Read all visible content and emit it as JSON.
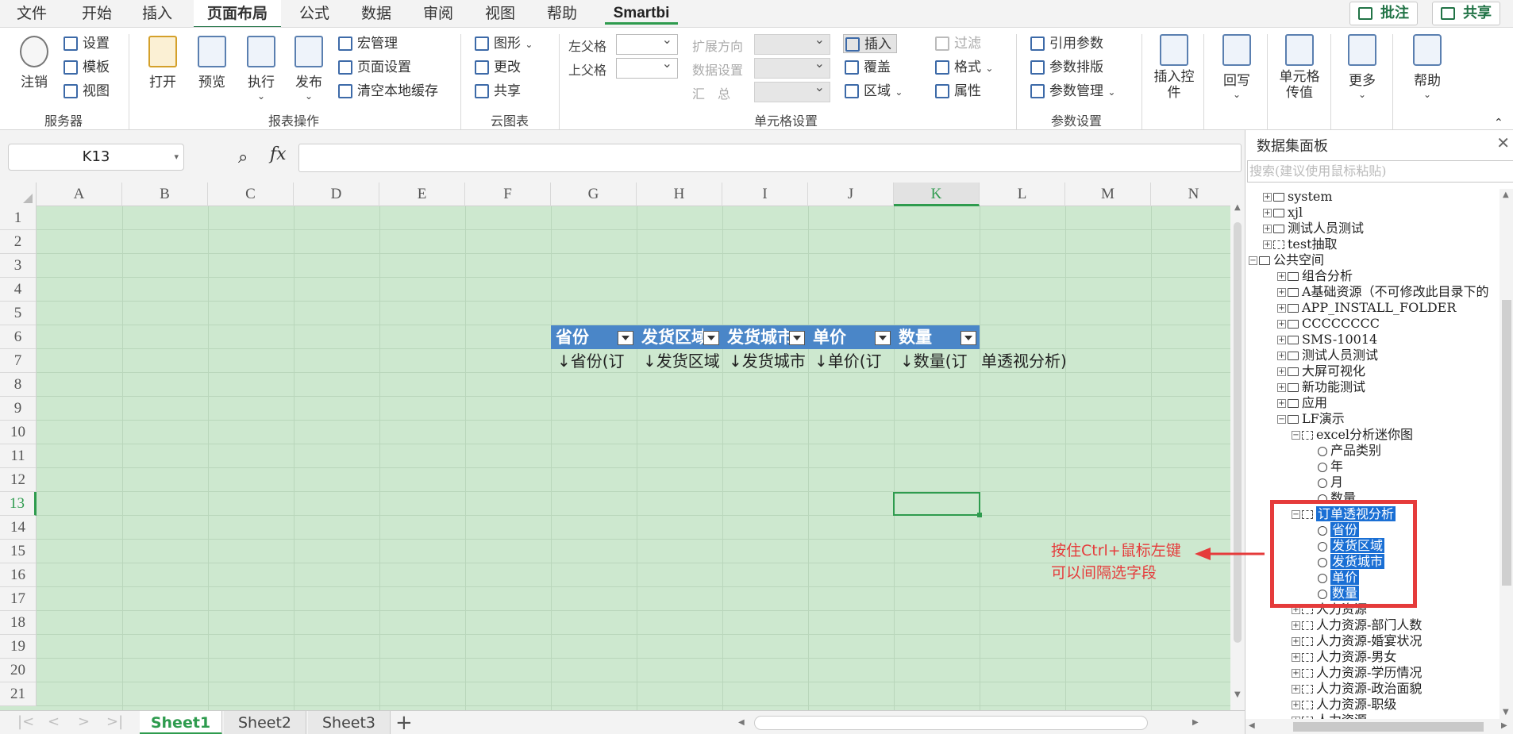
{
  "tabs": [
    "文件",
    "开始",
    "插入",
    "页面布局",
    "公式",
    "数据",
    "审阅",
    "视图",
    "帮助",
    "Smartbi"
  ],
  "active_tab": "页面布局",
  "top_buttons": {
    "comment": "批注",
    "share": "共享"
  },
  "ribbon": {
    "server": {
      "logout": "注销",
      "settings": "设置",
      "template": "模板",
      "view": "视图",
      "group": "服务器"
    },
    "report": {
      "open": "打开",
      "preview": "预览",
      "execute": "执行",
      "publish": "发布",
      "macro": "宏管理",
      "page_setup": "页面设置",
      "clear_cache": "清空本地缓存",
      "group": "报表操作"
    },
    "cloud": {
      "chart": "图形",
      "change": "更改",
      "share": "共享",
      "group": "云图表"
    },
    "cell": {
      "left_parent": "左父格",
      "top_parent": "上父格",
      "expand_dir": "扩展方向",
      "data_setting": "数据设置",
      "summary": "汇　总",
      "insert": "插入",
      "overwrite": "覆盖",
      "area": "区域",
      "filter": "过滤",
      "format": "格式",
      "attribute": "属性",
      "group": "单元格设置"
    },
    "param": {
      "ref": "引用参数",
      "layout": "参数排版",
      "manage": "参数管理",
      "group": "参数设置"
    },
    "extra": {
      "insert_ctrl": "插入控件",
      "writeback": "回写",
      "cell_pass": "单元格传值",
      "more": "更多",
      "help": "帮助"
    }
  },
  "name_box": "K13",
  "formula_value": "",
  "columns": [
    "A",
    "B",
    "C",
    "D",
    "E",
    "F",
    "G",
    "H",
    "I",
    "J",
    "K",
    "L",
    "M",
    "N"
  ],
  "selected_column": "K",
  "rows": [
    "1",
    "2",
    "3",
    "4",
    "5",
    "6",
    "7",
    "8",
    "9",
    "10",
    "11",
    "12",
    "13",
    "14",
    "15",
    "16",
    "17",
    "18",
    "19",
    "20",
    "21"
  ],
  "selected_row": "13",
  "table_headers": [
    "省份",
    "发货区域",
    "发货城市",
    "单价",
    "数量"
  ],
  "table_data_cells": [
    "↓省份(订",
    "↓发货区域",
    "↓发货城市",
    "↓单价(订",
    "↓数量(订"
  ],
  "table_data_tail": "单透视分析)",
  "sheets": [
    "Sheet1",
    "Sheet2",
    "Sheet3"
  ],
  "active_sheet": "Sheet1",
  "panel": {
    "title": "数据集面板",
    "search_placeholder": "搜索(建议使用鼠标粘贴)",
    "tree": [
      {
        "label": "system",
        "icon": "folder",
        "box": "+"
      },
      {
        "label": "xjl",
        "icon": "folder",
        "box": "+"
      },
      {
        "label": "测试人员测试",
        "icon": "folder",
        "box": "+"
      },
      {
        "label": "test抽取",
        "icon": "report",
        "box": "+"
      },
      {
        "label": "公共空间",
        "icon": "folder",
        "box": "−"
      },
      {
        "label": "组合分析",
        "icon": "combo",
        "box": "+"
      },
      {
        "label": "A基础资源（不可修改此目录下的",
        "icon": "folder",
        "box": "+"
      },
      {
        "label": "APP_INSTALL_FOLDER",
        "icon": "folder",
        "box": "+"
      },
      {
        "label": "CCCCCCCC",
        "icon": "folder",
        "box": "+"
      },
      {
        "label": "SMS-10014",
        "icon": "folder",
        "box": "+"
      },
      {
        "label": "测试人员测试",
        "icon": "folder",
        "box": "+"
      },
      {
        "label": "大屏可视化",
        "icon": "folder",
        "box": "+"
      },
      {
        "label": "新功能测试",
        "icon": "folder",
        "box": "+"
      },
      {
        "label": "应用",
        "icon": "folder",
        "box": "+"
      },
      {
        "label": "LF演示",
        "icon": "folder",
        "box": "−"
      },
      {
        "label": "excel分析迷你图",
        "icon": "report",
        "box": "−"
      },
      {
        "label": "产品类别",
        "icon": "field"
      },
      {
        "label": "年",
        "icon": "field"
      },
      {
        "label": "月",
        "icon": "field"
      },
      {
        "label": "数量",
        "icon": "field"
      },
      {
        "label": "订单透视分析",
        "icon": "report",
        "box": "−",
        "hl": true
      },
      {
        "label": "省份",
        "icon": "field",
        "hl": true
      },
      {
        "label": "发货区域",
        "icon": "field",
        "hl": true
      },
      {
        "label": "发货城市",
        "icon": "field",
        "hl": true
      },
      {
        "label": "单价",
        "icon": "field",
        "hl": true
      },
      {
        "label": "数量",
        "icon": "field",
        "hl": true
      },
      {
        "label": "人力资源",
        "icon": "report",
        "box": "+"
      },
      {
        "label": "人力资源-部门人数",
        "icon": "report",
        "box": "+"
      },
      {
        "label": "人力资源-婚宴状况",
        "icon": "report",
        "box": "+"
      },
      {
        "label": "人力资源-男女",
        "icon": "report",
        "box": "+"
      },
      {
        "label": "人力资源-学历情况",
        "icon": "report",
        "box": "+"
      },
      {
        "label": "人力资源-政治面貌",
        "icon": "report",
        "box": "+"
      },
      {
        "label": "人力资源-职级",
        "icon": "report",
        "box": "+"
      },
      {
        "label": "人力资源",
        "icon": "report",
        "box": "+"
      }
    ]
  },
  "annotation": {
    "line1": "按住Ctrl+鼠标左键",
    "line2": "可以间隔选字段"
  },
  "colors": {
    "accent": "#217346",
    "smartbi_green": "#2e9b4e",
    "grid_bg": "#cde8cf",
    "header_blue": "#4a86c8",
    "highlight": "#1a6fd4",
    "annotation_red": "#e53b3b"
  }
}
